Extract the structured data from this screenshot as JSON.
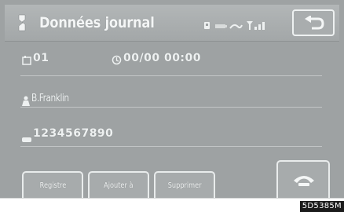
{
  "header": {
    "title": "Données journal",
    "title_icon": "phone-book-icon",
    "status_icons": [
      "phone-status-icon",
      "battery-icon",
      "signal-icon",
      "antenna-icon"
    ],
    "back_icon": "back-arrow-icon"
  },
  "entry": {
    "index": "01",
    "index_icon": "memory-icon",
    "datetime": "00/00 00:00",
    "datetime_icon": "clock-icon",
    "name": "B.Franklin",
    "name_icon": "person-icon",
    "number": "1234567890",
    "number_icon": "phone-number-icon"
  },
  "buttons": {
    "register": "Registre",
    "add": "Ajouter à",
    "delete": "Supprimer",
    "call_icon": "phone-call-icon"
  },
  "figure_code": "5D5385M",
  "colors": {
    "screen_bg": "#9ea2a3",
    "text": "#eef1f1"
  }
}
